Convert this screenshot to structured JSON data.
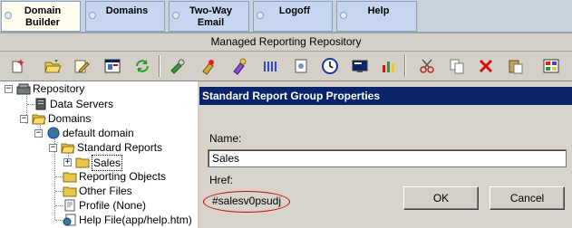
{
  "nav": {
    "tabs": [
      {
        "label": "Domain\nBuilder",
        "active": true
      },
      {
        "label": "Domains",
        "active": false
      },
      {
        "label": "Two-Way\nEmail",
        "active": false
      },
      {
        "label": "Logoff",
        "active": false
      },
      {
        "label": "Help",
        "active": false
      }
    ]
  },
  "window": {
    "title": "Managed Reporting Repository"
  },
  "toolbar": {
    "icons": [
      "new-icon",
      "open-folder-icon",
      "edit-icon",
      "properties-icon",
      "refresh-icon",
      "tool1-icon",
      "tool2-icon",
      "tool3-icon",
      "columns-icon",
      "report-icon",
      "clock-icon",
      "screen-icon",
      "chart-icon",
      "cut-icon",
      "copy-icon",
      "delete-icon",
      "paste-icon",
      "settings-icon"
    ]
  },
  "tree": {
    "root": "Repository",
    "data_servers": "Data Servers",
    "domains": "Domains",
    "default_domain": "default domain",
    "standard_reports": "Standard Reports",
    "sales": "Sales",
    "reporting_objects": "Reporting Objects",
    "other_files": "Other Files",
    "profile": "Profile (None)",
    "help_file": "Help File(app/help.htm)"
  },
  "panel": {
    "header": "Standard Report Group Properties",
    "name_label": "Name:",
    "name_value": "Sales",
    "href_label": "Href:",
    "href_value": "#salesv0psudj",
    "ok_label": "OK",
    "cancel_label": "Cancel"
  },
  "colors": {
    "panel_header": "#0a246a",
    "nav_tab": "#c6d6f0",
    "nav_active": "#fffdf0",
    "href_highlight": "#cc0000"
  }
}
